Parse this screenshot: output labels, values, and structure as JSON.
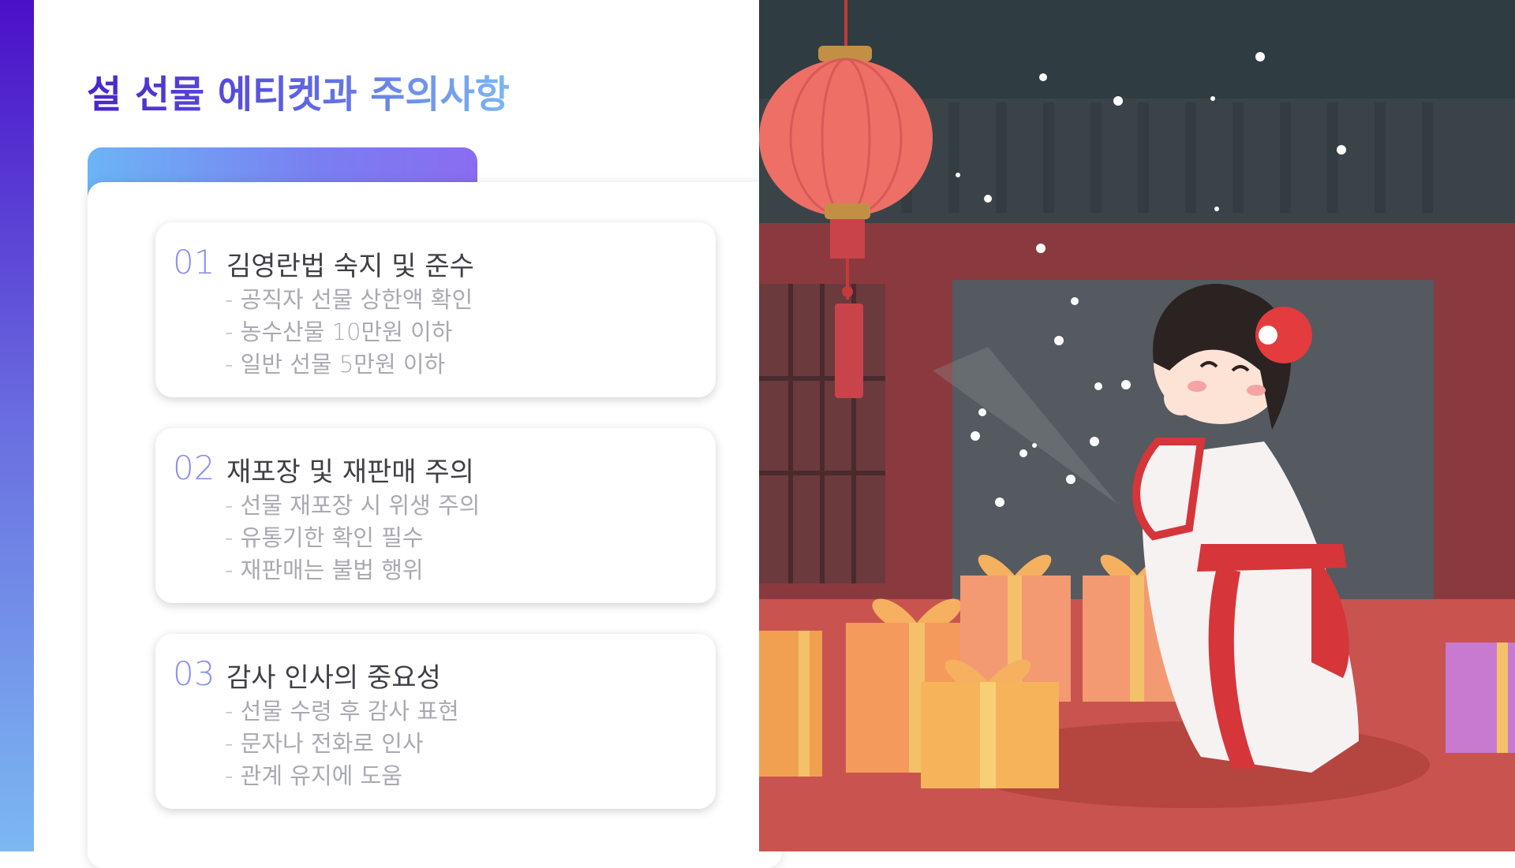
{
  "title": "설 선물 에티켓과 주의사항",
  "cards": [
    {
      "number": "01",
      "heading": "김영란법 숙지 및 준수",
      "bullets": [
        "- 공직자 선물 상한액 확인",
        "- 농수산물 10만원 이하",
        "- 일반 선물 5만원 이하"
      ]
    },
    {
      "number": "02",
      "heading": "재포장 및 재판매 주의",
      "bullets": [
        "- 선물 재포장 시 위생 주의",
        "- 유통기한 확인 필수",
        "- 재판매는 불법 행위"
      ]
    },
    {
      "number": "03",
      "heading": "감사 인사의 중요성",
      "bullets": [
        "- 선물 수령 후 감사 표현",
        "- 문자나 전화로 인사",
        "- 관계 유지에 도움"
      ]
    }
  ],
  "colors": {
    "accent_purple": "#4a24c8",
    "accent_blue": "#7bb8f2",
    "number": "#8a90ee",
    "heading": "#3f3f46",
    "bullet": "#a9a9b1"
  },
  "illustration": {
    "subject": "girl in hanbok bowing with lunar new year gifts",
    "icons": [
      "red-lantern-icon",
      "gift-box-icon"
    ]
  }
}
